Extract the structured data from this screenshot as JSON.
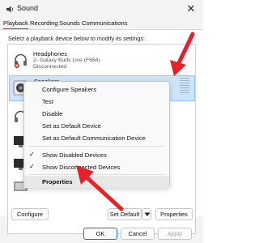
{
  "window": {
    "title": "Sound",
    "close_glyph": "✕"
  },
  "tabs": [
    {
      "label": "Playback",
      "active": true
    },
    {
      "label": "Recording",
      "active": false
    },
    {
      "label": "Sounds",
      "active": false
    },
    {
      "label": "Communications",
      "active": false
    }
  ],
  "instruction": "Select a playback device below to modify its settings:",
  "devices": [
    {
      "name": "Headphones",
      "subtitle1": "2- Galaxy Buds Live (F684)",
      "subtitle2": "Disconnected",
      "icon": "headphones-icon"
    },
    {
      "name": "Speakers",
      "icon": "speaker-icon",
      "selected": true
    }
  ],
  "context_menu": {
    "items": [
      {
        "label": "Configure Speakers",
        "checked": false
      },
      {
        "label": "Test",
        "checked": false
      },
      {
        "label": "Disable",
        "checked": false
      },
      {
        "label": "Set as Default Device",
        "checked": false
      },
      {
        "label": "Set as Default Communication Device",
        "checked": false
      },
      {
        "label": "Show Disabled Devices",
        "checked": true
      },
      {
        "label": "Show Disconnected Devices",
        "checked": true
      },
      {
        "label": "Properties",
        "checked": false,
        "bold": true,
        "highlighted": true
      }
    ],
    "check_glyph": "✓"
  },
  "buttons": {
    "configure": "Configure",
    "set_default": "Set Default",
    "properties": "Properties",
    "ok": "OK",
    "cancel": "Cancel",
    "apply": "Apply"
  },
  "colors": {
    "accent": "#1a6fd0",
    "arrow": "#e8202a",
    "selection": "#cce4f7"
  }
}
